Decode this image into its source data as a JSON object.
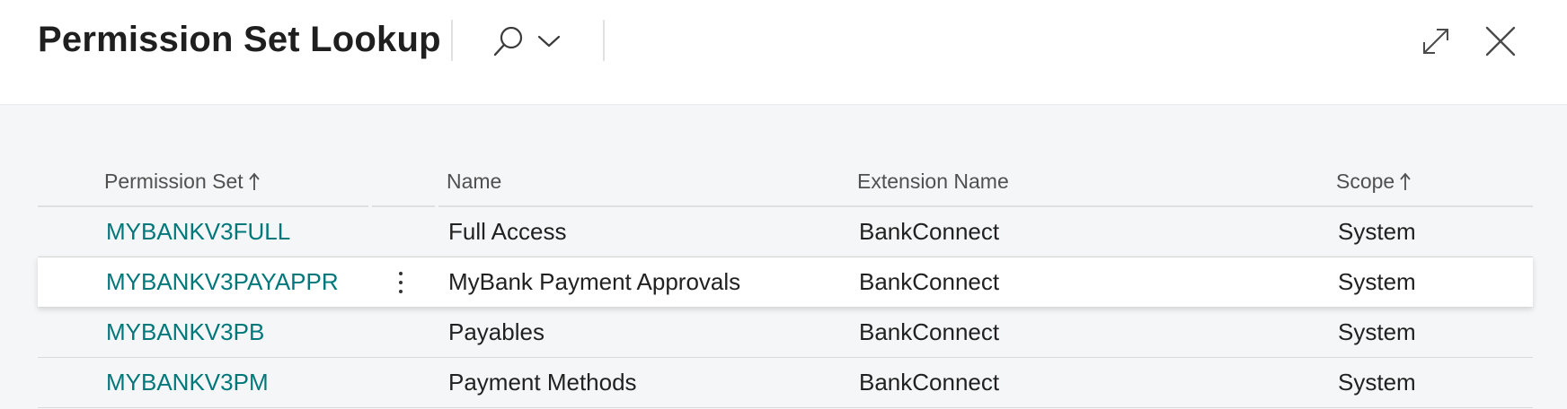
{
  "header": {
    "title": "Permission Set Lookup",
    "search_icon": "search-icon",
    "filter_icon": "chevron-down-icon",
    "expand_icon": "expand-icon",
    "close_icon": "close-icon"
  },
  "table": {
    "columns": [
      {
        "label": "Permission Set",
        "sorted": "ascending"
      },
      {
        "label": "Name",
        "sorted": ""
      },
      {
        "label": "Extension Name",
        "sorted": ""
      },
      {
        "label": "Scope",
        "sorted": "ascending"
      }
    ],
    "rows": [
      {
        "permission_set": "MYBANKV3FULL",
        "name": "Full Access",
        "extension_name": "BankConnect",
        "scope": "System"
      },
      {
        "permission_set": "MYBANKV3PAYAPPR",
        "name": "MyBank Payment Approvals",
        "extension_name": "BankConnect",
        "scope": "System"
      },
      {
        "permission_set": "MYBANKV3PB",
        "name": "Payables",
        "extension_name": "BankConnect",
        "scope": "System"
      },
      {
        "permission_set": "MYBANKV3PM",
        "name": "Payment Methods",
        "extension_name": "BankConnect",
        "scope": "System"
      }
    ],
    "selected_row_index": 1
  },
  "colors": {
    "link": "#00777a",
    "content_bg": "#f5f6f7",
    "title": "#1f1f1f"
  }
}
